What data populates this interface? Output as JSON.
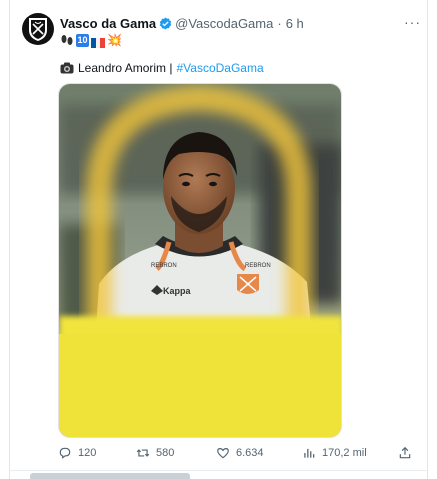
{
  "tweet": {
    "author_name": "Vasco da Gama",
    "handle": "@VascodaGama",
    "separator": "·",
    "time_ago": "6 h",
    "more_label": "···",
    "emoji_line": {
      "number_label": "10",
      "flag_colors": [
        "#0055a4",
        "#ffffff",
        "#ef4135"
      ],
      "burst": "💥",
      "prefix_icon": "footprints-icon"
    },
    "credit_icon": "camera-icon",
    "credit_text": "Leandro Amorim |",
    "hashtag": "#VascoDaGama",
    "image_alt": "player-photo",
    "accent_color": "#1d9bf0",
    "shirt_sponsor": "REBRON",
    "shirt_brand": "Kappa",
    "stats": {
      "replies": "120",
      "retweets": "580",
      "likes": "6.634",
      "views": "170,2 mil"
    }
  }
}
